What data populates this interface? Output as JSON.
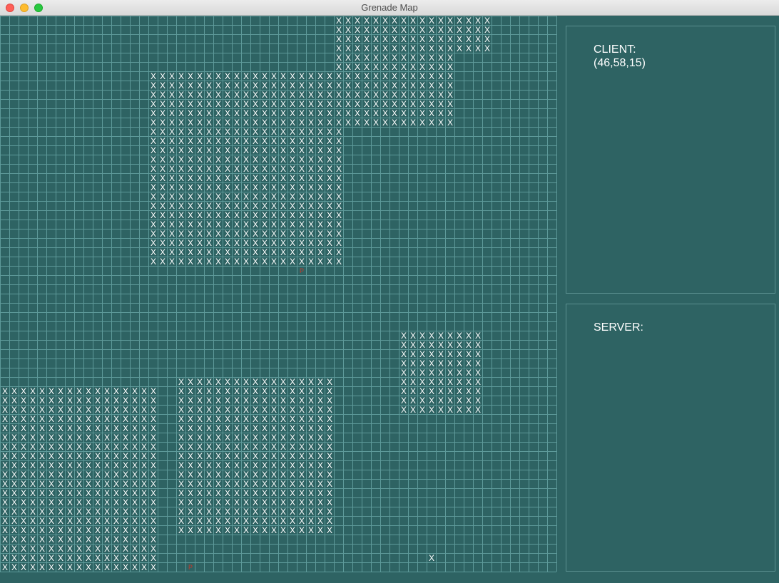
{
  "window": {
    "title": "Grenade Map"
  },
  "map": {
    "cols": 60,
    "rows": 60,
    "cell_glyph": "X",
    "grid_color": "#5e9a9a",
    "background_color": "#2e6363",
    "mark_color": "#ffffff",
    "player_color": "#c0392b",
    "player_glyph": "P",
    "regions": [
      {
        "c0": 36,
        "c1": 52,
        "r0": 0,
        "r1": 3
      },
      {
        "c0": 36,
        "c1": 48,
        "r0": 4,
        "r1": 5
      },
      {
        "c0": 16,
        "c1": 48,
        "r0": 6,
        "r1": 11
      },
      {
        "c0": 16,
        "c1": 36,
        "r0": 12,
        "r1": 26
      },
      {
        "c0": 43,
        "c1": 51,
        "r0": 34,
        "r1": 42
      },
      {
        "c0": 19,
        "c1": 35,
        "r0": 39,
        "r1": 55
      },
      {
        "c0": 0,
        "c1": 16,
        "r0": 40,
        "r1": 59
      }
    ],
    "single_marks": [
      {
        "c": 46,
        "r": 58
      }
    ],
    "players": [
      {
        "c": 32,
        "r": 27
      },
      {
        "c": 20,
        "r": 59
      }
    ]
  },
  "client_panel": {
    "label": "CLIENT:",
    "value": "(46,58,15)"
  },
  "server_panel": {
    "label": "SERVER:"
  }
}
